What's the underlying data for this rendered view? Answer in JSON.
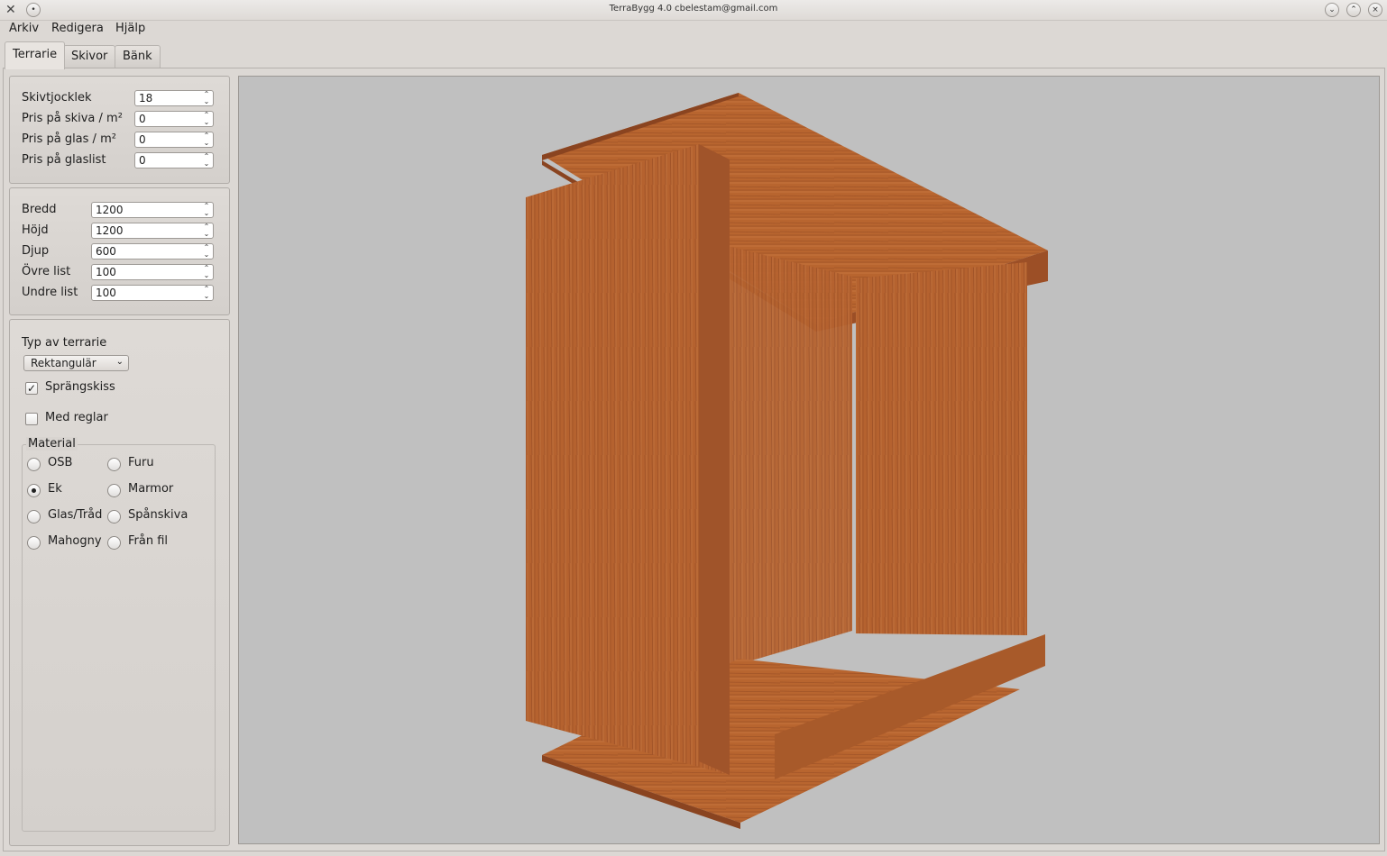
{
  "window": {
    "title": "TerraBygg 4.0 cbelestam@gmail.com"
  },
  "menu": [
    "Arkiv",
    "Redigera",
    "Hjälp"
  ],
  "tabs": [
    "Terrarie",
    "Skivor",
    "Bänk"
  ],
  "panel1": {
    "fields": [
      {
        "label": "Skivtjocklek",
        "value": "18"
      },
      {
        "label": "Pris på skiva / m²",
        "value": "0"
      },
      {
        "label": "Pris på glas / m²",
        "value": "0"
      },
      {
        "label": "Pris på glaslist",
        "value": "0"
      }
    ]
  },
  "panel2": {
    "fields": [
      {
        "label": "Bredd",
        "value": "1200"
      },
      {
        "label": "Höjd",
        "value": "1200"
      },
      {
        "label": "Djup",
        "value": "600"
      },
      {
        "label": "Övre list",
        "value": "100"
      },
      {
        "label": "Undre list",
        "value": "100"
      }
    ]
  },
  "panel3": {
    "type_label": "Typ av terrarie",
    "type_value": "Rektangulär",
    "exploded_label": "Sprängskiss",
    "exploded_checked": true,
    "studs_label": "Med reglar",
    "studs_checked": false,
    "material_label": "Material",
    "materials": [
      "OSB",
      "Furu",
      "Ek",
      "Marmor",
      "Glas/Tråd",
      "Spånskiva",
      "Mahogny",
      "Från fil"
    ],
    "selected_material": "Ek"
  },
  "colors": {
    "viewport_bg": "#c0c0c0",
    "wood_light": "#c2703a",
    "wood_mid": "#a85a2a",
    "wood_dark": "#8a4420"
  }
}
